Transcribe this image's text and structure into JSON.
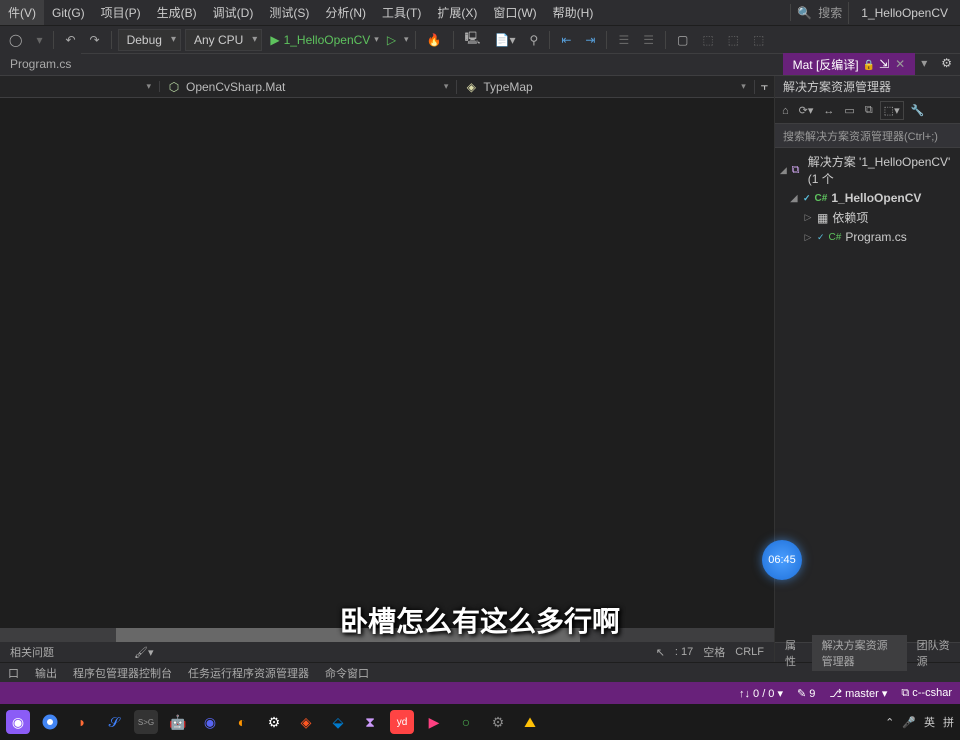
{
  "menu": {
    "items": [
      "件(V)",
      "Git(G)",
      "项目(P)",
      "生成(B)",
      "调试(D)",
      "测试(S)",
      "分析(N)",
      "工具(T)",
      "扩展(X)",
      "窗口(W)",
      "帮助(H)"
    ],
    "search_label": "搜索",
    "project_name": "1_HelloOpenCV"
  },
  "toolbar": {
    "config": "Debug",
    "platform": "Any CPU",
    "run_target": "1_HelloOpenCV"
  },
  "tabs": {
    "left": "Program.cs",
    "right": "Mat [反编译]"
  },
  "nav": {
    "left": "OpenCvSharp.Mat",
    "right": "TypeMap"
  },
  "solution": {
    "panel_title": "解决方案资源管理器",
    "search_placeholder": "搜索解决方案资源管理器(Ctrl+;)",
    "root": "解决方案 '1_HelloOpenCV' (1 个",
    "project": "1_HelloOpenCV",
    "deps": "依赖项",
    "file": "Program.cs"
  },
  "bottom": {
    "issues": "相关问题",
    "output_left": "口",
    "output": "输出",
    "pkg": "程序包管理器控制台",
    "task": "任务运行程序资源管理器",
    "cmd": "命令窗口"
  },
  "right_tabs": {
    "prop": "属性",
    "sln": "解决方案资源管理器",
    "team": "团队资源"
  },
  "status_right": {
    "col": ": 17",
    "space": "空格",
    "crlf": "CRLF"
  },
  "statusbar": {
    "nav": "0 / 0",
    "changes": "9",
    "branch": "master",
    "repo": "c--cshar"
  },
  "subtitle": "卧槽怎么有这么多行啊",
  "timer": "06:45",
  "taskbar_right": {
    "ime1": "英",
    "ime2": "拼"
  }
}
